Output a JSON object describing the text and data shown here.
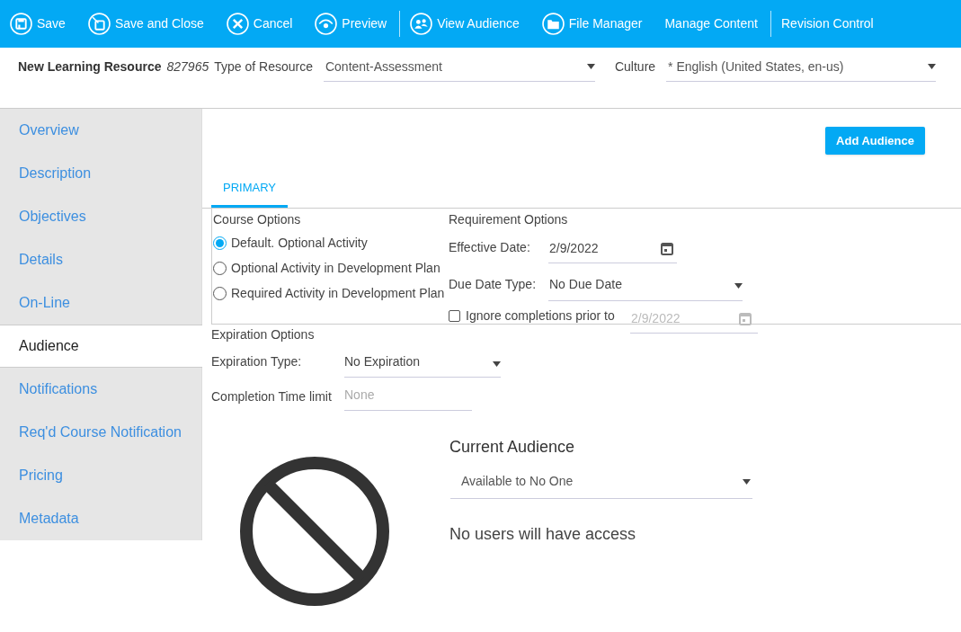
{
  "toolbar_groups": [
    [
      {
        "label": "Save",
        "kind": "save"
      },
      {
        "label": "Save and Close",
        "kind": "saveclose"
      },
      {
        "label": "Cancel",
        "kind": "cancel"
      },
      {
        "label": "Preview",
        "kind": "preview"
      }
    ],
    [
      {
        "label": "View Audience",
        "kind": "audience"
      },
      {
        "label": "File Manager",
        "kind": "folder"
      },
      {
        "label": "Manage Content",
        "kind": "text"
      }
    ],
    [
      {
        "label": "Revision Control",
        "kind": "text"
      }
    ]
  ],
  "header": {
    "title": "New Learning Resource",
    "id": "827965",
    "type_label": "Type of Resource",
    "type_value": "Content-Assessment",
    "culture_label": "Culture",
    "culture_value": "* English (United States, en-us)"
  },
  "sidebar": [
    {
      "label": "Overview",
      "selected": false
    },
    {
      "label": "Description",
      "selected": false
    },
    {
      "label": "Objectives",
      "selected": false
    },
    {
      "label": "Details",
      "selected": false
    },
    {
      "label": "On-Line",
      "selected": false
    },
    {
      "label": "Audience",
      "selected": true
    },
    {
      "label": "Notifications",
      "selected": false
    },
    {
      "label": "Req'd Course Notification",
      "selected": false
    },
    {
      "label": "Pricing",
      "selected": false
    },
    {
      "label": "Metadata",
      "selected": false
    }
  ],
  "add_audience_button": "Add Audience",
  "tabs": [
    {
      "label": "PRIMARY",
      "selected": true
    }
  ],
  "course_options": {
    "title": "Course Options",
    "options": [
      {
        "label": "Default. Optional Activity",
        "selected": true
      },
      {
        "label": "Optional Activity in Development Plan",
        "selected": false
      },
      {
        "label": "Required Activity in Development Plan",
        "selected": false
      }
    ]
  },
  "requirement_options": {
    "title": "Requirement Options",
    "effective_date_label": "Effective Date:",
    "effective_date": "2/9/2022",
    "due_date_type_label": "Due Date Type:",
    "due_date_type": "No Due Date",
    "ignore": {
      "label": "Ignore completions prior to",
      "checked": false,
      "date": "2/9/2022",
      "disabled": true
    }
  },
  "expiration": {
    "title": "Expiration Options",
    "type_label": "Expiration Type:",
    "type_value": "No Expiration",
    "time_limit_label": "Completion Time limit",
    "time_limit_placeholder": "None"
  },
  "current_audience": {
    "title": "Current Audience",
    "value": "Available to No One",
    "message": "No users will have access"
  }
}
